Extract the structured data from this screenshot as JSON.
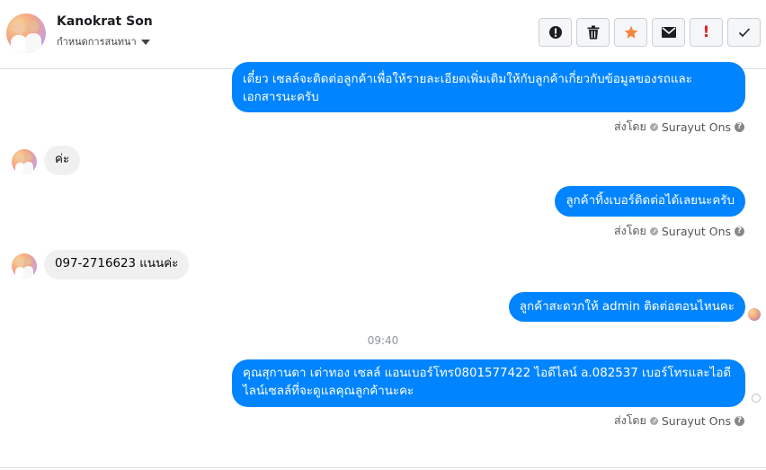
{
  "header": {
    "contact_name": "Kanokrat Son",
    "status_label": "กำหนดการสนทนา",
    "actions": [
      {
        "name": "report-icon",
        "label": "!"
      },
      {
        "name": "trash-icon"
      },
      {
        "name": "star-icon",
        "color": "#f5853f"
      },
      {
        "name": "envelope-icon"
      },
      {
        "name": "exclamation-icon",
        "label": "!",
        "color": "#e02424"
      },
      {
        "name": "check-icon"
      }
    ]
  },
  "messages": [
    {
      "side": "out",
      "text_line1": "เดี๋ยว เซลล์จะติดต่อลูกค้าเพื่อให้รายละเอียดเพิ่มเติมให้กับลูกค้าเกี่ยวกับข้อมูลของรถและ",
      "text_line2": "เอกสารนะครับ"
    },
    {
      "side": "in",
      "text": "ค่ะ"
    },
    {
      "side": "out",
      "text": "ลูกค้าทิ้งเบอร์ติดต่อได้เลยนะครับ"
    },
    {
      "side": "in",
      "text": "097-2716623 แนนค่ะ"
    },
    {
      "side": "out",
      "text": "ลูกค้าสะดวกให้ admin ติดต่อตอนไหนคะ"
    },
    {
      "side": "out",
      "text_line1": "คุณสุกานดา เต่าทอง  เซลล์ แอนเบอร์โทร0801577422 ไอดีไลน์ a.082537  เบอร์โทรและไอดี",
      "text_line2": "ไลน์เซลล์ที่จะดูแลคุณลูกค้านะคะ"
    }
  ],
  "sent_by": {
    "prefix": "ส่งโดย",
    "agent": "Surayut Ons",
    "help": "?"
  },
  "time_separator": "09:40",
  "brand_color": "#0084ff"
}
